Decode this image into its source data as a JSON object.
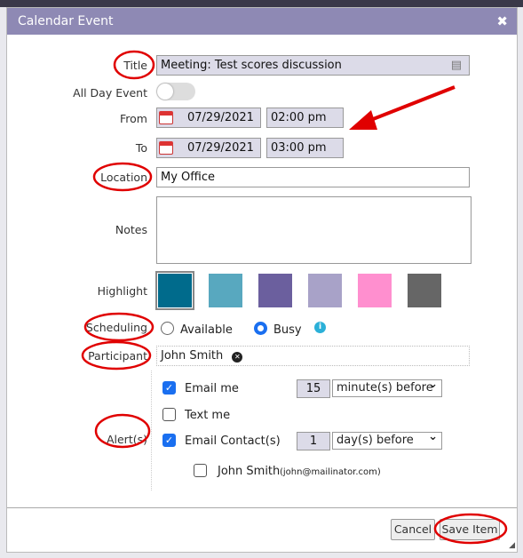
{
  "dialog": {
    "title": "Calendar Event",
    "close_icon": "close-icon"
  },
  "form": {
    "title_label": "Title",
    "title_value": "Meeting: Test scores discussion",
    "allday_label": "All Day Event",
    "allday_on": false,
    "from_label": "From",
    "from_date": "07/29/2021",
    "from_time": "02:00 pm",
    "to_label": "To",
    "to_date": "07/29/2021",
    "to_time": "03:00 pm",
    "location_label": "Location",
    "location_value": "My Office",
    "notes_label": "Notes",
    "notes_value": "",
    "highlight_label": "Highlight",
    "highlight_colors": [
      "#006b8c",
      "#58a8bf",
      "#6b5f9e",
      "#a8a2c8",
      "#ff8fcf",
      "#666666"
    ],
    "scheduling_label": "Scheduling",
    "available_label": "Available",
    "busy_label": "Busy",
    "scheduling_value": "Busy",
    "participant_label": "Participant",
    "participant_name": "John Smith",
    "alerts_label": "Alert(s)",
    "alerts": {
      "email_me": {
        "label": "Email me",
        "checked": true,
        "amount": "15",
        "unit": "minute(s) before"
      },
      "text_me": {
        "label": "Text me",
        "checked": false
      },
      "email_contacts": {
        "label": "Email Contact(s)",
        "checked": true,
        "amount": "1",
        "unit": "day(s) before"
      },
      "contact": {
        "name": "John Smith",
        "email": "(john@mailinator.com)",
        "checked": false
      }
    }
  },
  "footer": {
    "cancel": "Cancel",
    "save": "Save Item"
  },
  "colors": {
    "header": "#8e89b4",
    "accent": "#1a6ff0",
    "annotation": "#e00000"
  }
}
